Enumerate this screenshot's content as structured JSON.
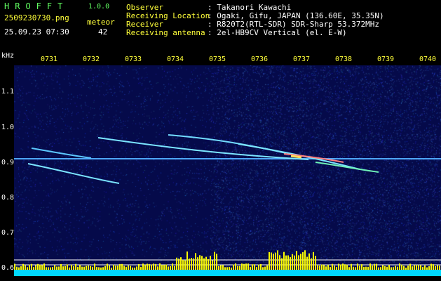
{
  "header": {
    "logo": "HROFFT",
    "version": "1.0.0",
    "filename": "2509230730.png",
    "datetime": "25.09.23 07:30",
    "meteor_label": "meteor",
    "meteor_count": "42"
  },
  "info": {
    "observer_label": "Observer",
    "observer_value": ": Takanori Kawachi",
    "location_label": "Receiving Location",
    "location_value": ": Ogaki, Gifu, JAPAN (136.60E, 35.35N)",
    "receiver_label": "Receiver",
    "receiver_value": ": R820T2(RTL-SDR) SDR-Sharp 53.372MHz",
    "antenna_label": "Receiving antenna",
    "antenna_value": ": 2el-HB9CV Vertical (el. E-W)"
  },
  "axis": {
    "unit": "kHz",
    "time_ticks": [
      "0731",
      "0732",
      "0733",
      "0734",
      "0735",
      "0736",
      "0737",
      "0738",
      "0739",
      "0740"
    ],
    "freq_ticks": [
      "1.1",
      "1.0",
      "0.9",
      "0.8",
      "0.7",
      "0.6"
    ]
  },
  "colors": {
    "background": "#000000",
    "spectrogram_base": "#050a4a",
    "yellow_text": "#ffff3a",
    "green_text": "#62ff62",
    "signal_line": "#5fe0ff",
    "bottom_bar": "#00d8ff",
    "peaks": "#ffff00"
  }
}
